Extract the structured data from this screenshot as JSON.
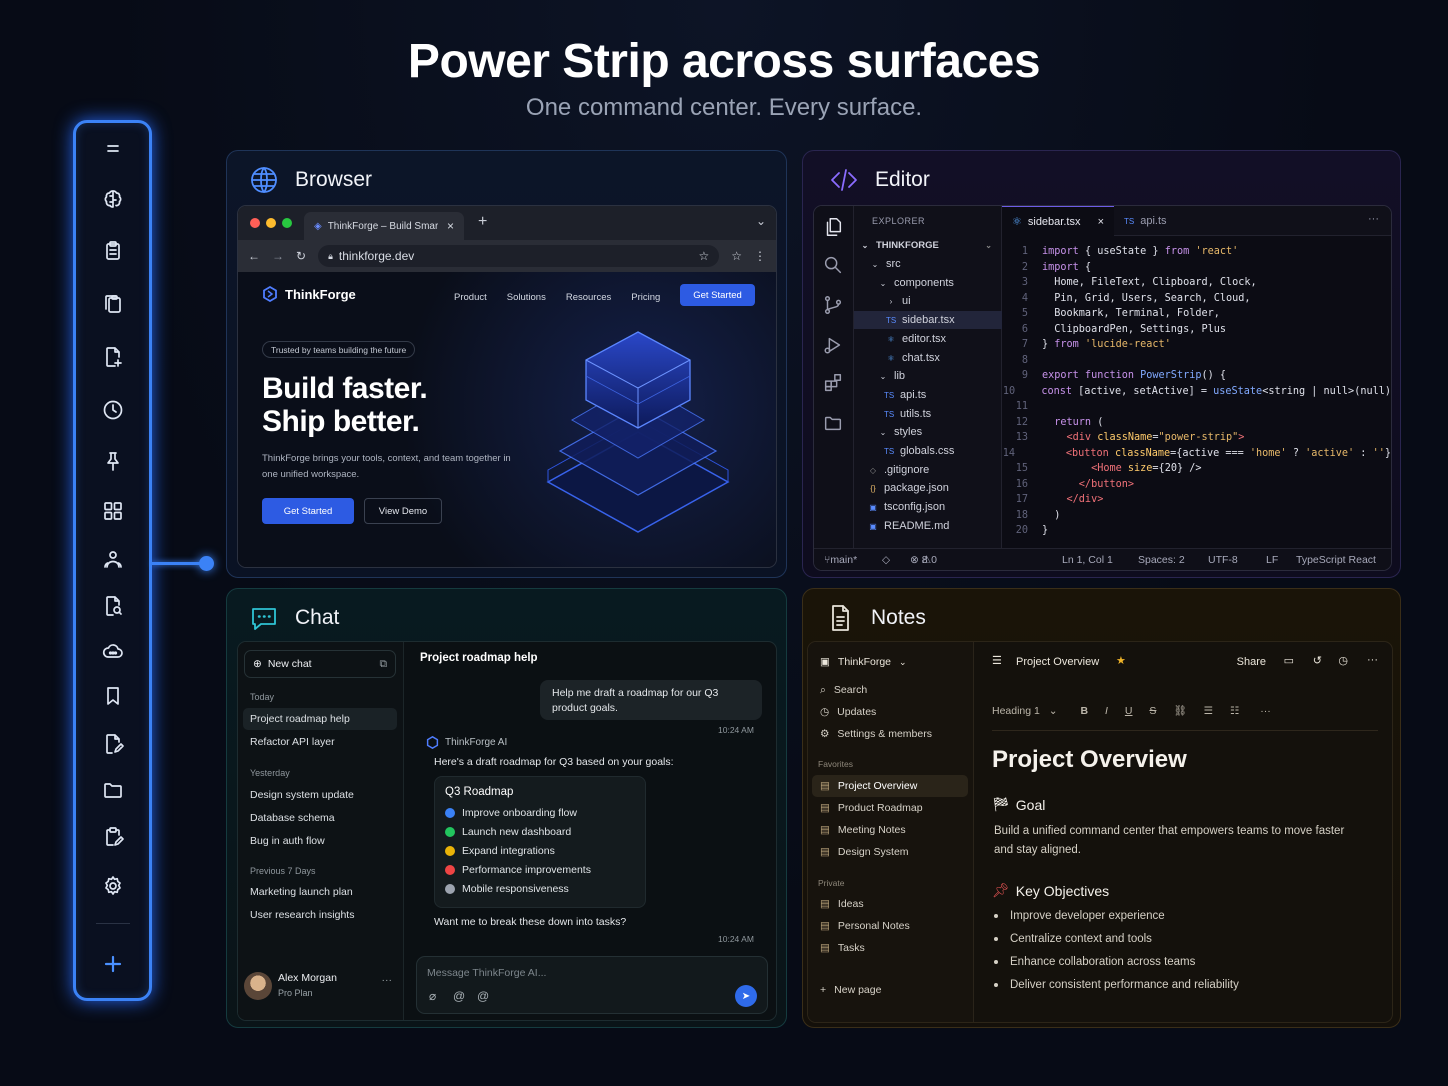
{
  "header": {
    "title": "Power Strip across surfaces",
    "subtitle": "One command center. Every surface."
  },
  "strip": {
    "icons": [
      "menu-icon",
      "brain-icon",
      "clipboard-icon",
      "clipboard-copy-icon",
      "file-plus-icon",
      "clock-icon",
      "pin-icon",
      "grid-icon",
      "users-icon",
      "file-search-icon",
      "cloud-icon",
      "bookmark-icon",
      "file-edit-icon",
      "folder-icon",
      "clipboard-pen-icon",
      "settings-icon",
      "plus-icon"
    ]
  },
  "browser": {
    "panel_title": "Browser",
    "tab_title": "ThinkForge – Build Smarter",
    "url": "thinkforge.dev",
    "brand": "ThinkForge",
    "nav": [
      "Product",
      "Solutions",
      "Resources",
      "Pricing"
    ],
    "cta": "Get Started",
    "badge": "Trusted by teams building the future",
    "hero_line1": "Build faster.",
    "hero_line2": "Ship better.",
    "hero_text": "ThinkForge brings your tools, context, and team together in one unified workspace.",
    "primary_button": "Get Started",
    "secondary_button": "View Demo"
  },
  "editor": {
    "panel_title": "Editor",
    "explorer_label": "EXPLORER",
    "tabs": [
      "sidebar.tsx",
      "api.ts"
    ],
    "tree": [
      {
        "label": "THINKFORGE"
      },
      {
        "label": "src"
      },
      {
        "label": "components"
      },
      {
        "label": "ui"
      },
      {
        "label": "sidebar.tsx"
      },
      {
        "label": "editor.tsx"
      },
      {
        "label": "chat.tsx"
      },
      {
        "label": "lib"
      },
      {
        "label": "api.ts"
      },
      {
        "label": "utils.ts"
      },
      {
        "label": "styles"
      },
      {
        "label": "globals.css"
      },
      {
        "label": ".gitignore"
      },
      {
        "label": "package.json"
      },
      {
        "label": "tsconfig.json"
      },
      {
        "label": "README.md"
      }
    ],
    "status": {
      "branch": "main*",
      "problems": "8",
      "warnings": "0",
      "position": "Ln 1, Col 1",
      "spaces": "Spaces: 2",
      "encoding": "UTF-8",
      "eol": "LF",
      "language": "TypeScript React"
    }
  },
  "chat": {
    "panel_title": "Chat",
    "new_chat": "New chat",
    "groups": {
      "today": "Today",
      "yesterday": "Yesterday",
      "prev": "Previous 7 Days"
    },
    "today": [
      "Project roadmap help",
      "Refactor API layer"
    ],
    "yesterday": [
      "Design system update",
      "Database schema",
      "Bug in auth flow"
    ],
    "prev": [
      "Marketing launch plan",
      "User research insights"
    ],
    "user": {
      "name": "Alex Morgan",
      "plan": "Pro Plan"
    },
    "conversation_title": "Project roadmap help",
    "user_message": "Help me draft a roadmap for our Q3 product goals.",
    "time1": "10:24 AM",
    "ai_name": "ThinkForge AI",
    "ai_intro": "Here's a draft roadmap for Q3 based on your goals:",
    "roadmap_title": "Q3 Roadmap",
    "roadmap": [
      {
        "label": "Improve onboarding flow",
        "color": "#3b82f6"
      },
      {
        "label": "Launch new dashboard",
        "color": "#22c55e"
      },
      {
        "label": "Expand integrations",
        "color": "#eab308"
      },
      {
        "label": "Performance improvements",
        "color": "#ef4444"
      },
      {
        "label": "Mobile responsiveness",
        "color": "#9ca3af"
      }
    ],
    "ai_question": "Want me to break these down into tasks?",
    "time2": "10:24 AM",
    "input_placeholder": "Message ThinkForge AI..."
  },
  "notes": {
    "panel_title": "Notes",
    "workspace": "ThinkForge",
    "menu": [
      "Search",
      "Updates",
      "Settings & members"
    ],
    "favorites_label": "Favorites",
    "favorites": [
      "Project Overview",
      "Product Roadmap",
      "Meeting Notes",
      "Design System"
    ],
    "private_label": "Private",
    "private": [
      "Ideas",
      "Personal Notes",
      "Tasks"
    ],
    "new_page": "New page",
    "page_title_bar": "Project Overview",
    "share": "Share",
    "block_type": "Heading 1",
    "doc_title": "Project Overview",
    "goal_heading": "Goal",
    "goal_text": "Build a unified command center that empowers teams to move faster and stay aligned.",
    "objectives_heading": "Key Objectives",
    "objectives": [
      "Improve developer experience",
      "Centralize context and tools",
      "Enhance collaboration across teams",
      "Deliver consistent performance and reliability"
    ]
  }
}
